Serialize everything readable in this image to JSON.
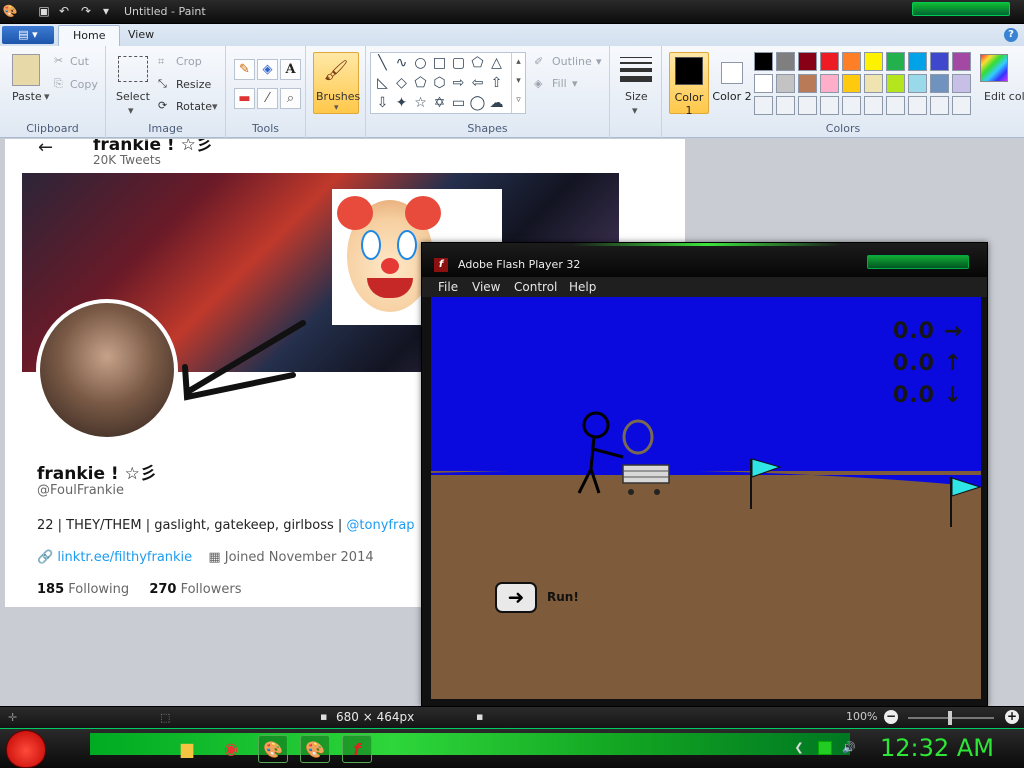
{
  "window": {
    "title": "Untitled - Paint"
  },
  "ribbon": {
    "file_menu": "▤ ▾",
    "tabs": [
      "Home",
      "View"
    ],
    "groups": {
      "clipboard": {
        "label": "Clipboard",
        "paste": "Paste",
        "cut": "Cut",
        "copy": "Copy"
      },
      "image": {
        "label": "Image",
        "select": "Select",
        "crop": "Crop",
        "resize": "Resize",
        "rotate": "Rotate"
      },
      "tools": {
        "label": "Tools"
      },
      "brushes": {
        "label": "Brushes"
      },
      "shapes": {
        "label": "Shapes",
        "outline": "Outline",
        "fill": "Fill"
      },
      "size": {
        "label": "Size"
      },
      "colors": {
        "label": "Colors",
        "color1": "Color 1",
        "color1_num": "1",
        "color2": "Color 2",
        "color2_num": "2",
        "edit": "Edit colors",
        "row1": [
          "#000000",
          "#7f7f7f",
          "#880015",
          "#ed1c24",
          "#ff7f27",
          "#fff200",
          "#22b14c",
          "#00a2e8",
          "#3f48cc",
          "#a349a4"
        ],
        "row2": [
          "#ffffff",
          "#c3c3c3",
          "#b97a57",
          "#ffaec9",
          "#ffc90e",
          "#efe4b0",
          "#b5e61d",
          "#99d9ea",
          "#7092be",
          "#c8bfe7"
        ]
      }
    }
  },
  "twitter": {
    "name_top": "frankie ! ☆彡",
    "tweets": "20K Tweets",
    "name": "frankie ! ☆彡",
    "handle": "@FoulFrankie",
    "bio": "22 | THEY/THEM | gaslight, gatekeep, girlboss |",
    "bio_link": "@tonyfrap",
    "link": "linktr.ee/filthyfrankie",
    "joined": "Joined November 2014",
    "following_count": "185",
    "following_label": "Following",
    "followers_count": "270",
    "followers_label": "Followers"
  },
  "flash": {
    "title": "Adobe Flash Player 32",
    "menu": [
      "File",
      "View",
      "Control",
      "Help"
    ],
    "scores": [
      "0.0 →",
      "0.0 ↑",
      "0.0 ↓"
    ],
    "run_label": "Run!"
  },
  "statusbar": {
    "size": "680 × 464px",
    "zoom": "100%"
  },
  "taskbar": {
    "clock": "12:32 AM"
  }
}
